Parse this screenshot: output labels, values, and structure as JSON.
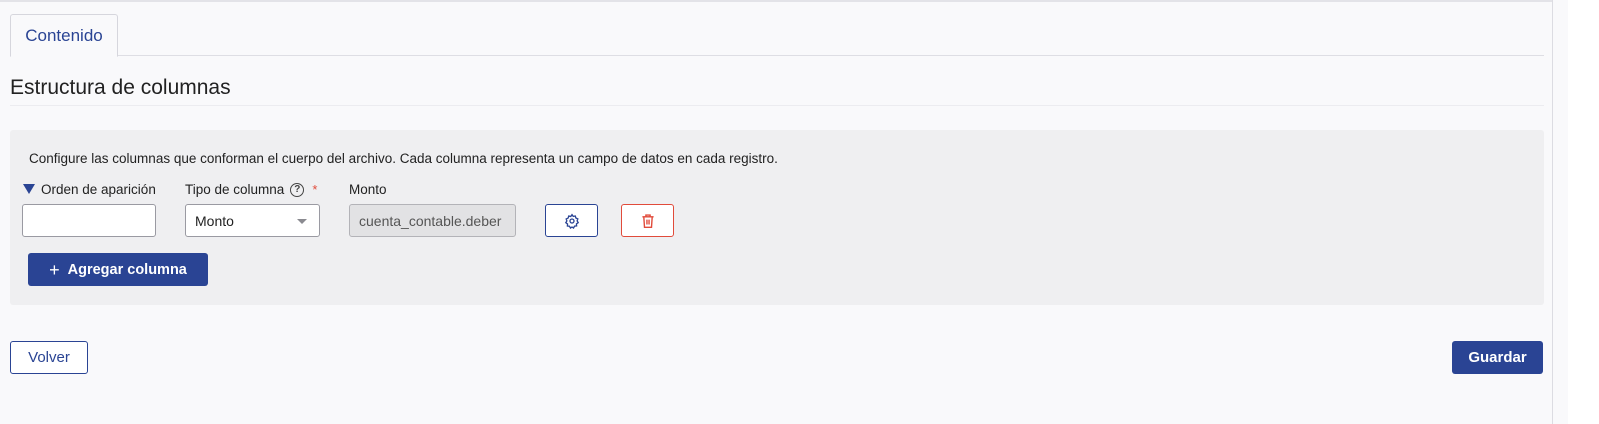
{
  "tabs": [
    {
      "label": "Contenido",
      "active": true
    }
  ],
  "section": {
    "title": "Estructura de columnas"
  },
  "panel": {
    "description": "Configure las columnas que conforman el cuerpo del archivo. Cada columna representa un campo de datos en cada registro.",
    "labels": {
      "order": "Orden de aparición",
      "type": "Tipo de columna",
      "required_mark": "*",
      "monto": "Monto"
    },
    "row": {
      "order_value": "",
      "type_value": "Monto",
      "monto_value": "cuenta_contable.deber"
    },
    "add_button": "Agregar columna"
  },
  "footer": {
    "back_button": "Volver",
    "save_button": "Guardar"
  },
  "colors": {
    "primary": "#2a4494",
    "danger": "#e14b3b",
    "panel_bg": "#efeff1"
  },
  "icons": [
    "sort-desc-icon",
    "help-circle-icon",
    "chevron-down-icon",
    "gear-icon",
    "trash-icon",
    "plus-icon"
  ]
}
